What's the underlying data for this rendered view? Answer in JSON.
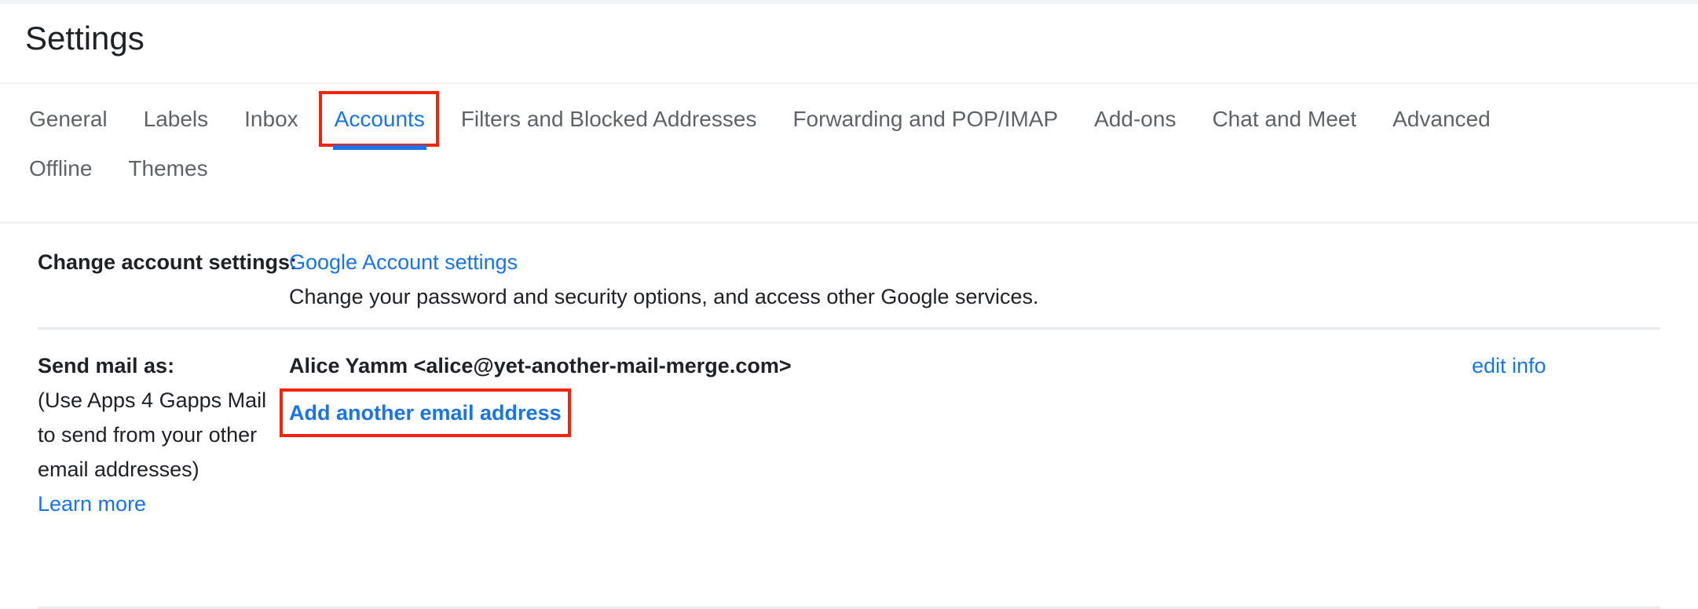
{
  "page": {
    "title": "Settings"
  },
  "tabs": {
    "row1": [
      {
        "label": "General",
        "active": false,
        "annotated": false
      },
      {
        "label": "Labels",
        "active": false,
        "annotated": false
      },
      {
        "label": "Inbox",
        "active": false,
        "annotated": false
      },
      {
        "label": "Accounts",
        "active": true,
        "annotated": true
      },
      {
        "label": "Filters and Blocked Addresses",
        "active": false,
        "annotated": false
      },
      {
        "label": "Forwarding and POP/IMAP",
        "active": false,
        "annotated": false
      },
      {
        "label": "Add-ons",
        "active": false,
        "annotated": false
      },
      {
        "label": "Chat and Meet",
        "active": false,
        "annotated": false
      },
      {
        "label": "Advanced",
        "active": false,
        "annotated": false
      }
    ],
    "row2": [
      {
        "label": "Offline",
        "active": false,
        "annotated": false
      },
      {
        "label": "Themes",
        "active": false,
        "annotated": false
      }
    ]
  },
  "sections": {
    "change_account": {
      "label": "Change account settings:",
      "link_label": "Google Account settings",
      "description": "Change your password and security options, and access other Google services."
    },
    "send_mail_as": {
      "label": "Send mail as:",
      "note": "(Use Apps 4 Gapps Mail to send from your other email addresses)",
      "learn_more_label": "Learn more",
      "identity": "Alice Yamm <alice@yet-another-mail-merge.com>",
      "edit_info_label": "edit info",
      "add_another_label": "Add another email address"
    }
  },
  "colors": {
    "link_blue": "#1a73e8",
    "annotation_red": "#f4230d",
    "text_primary": "#202124",
    "text_secondary": "#5f6368",
    "divider": "#e8eaed"
  }
}
